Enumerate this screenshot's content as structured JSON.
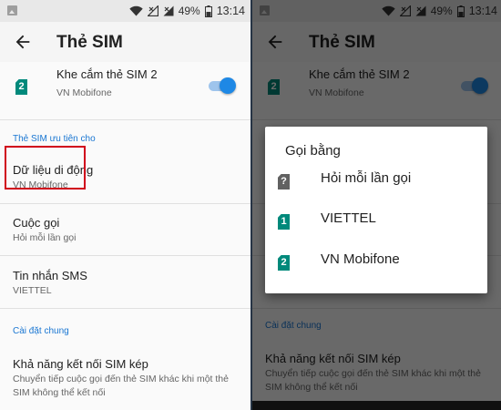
{
  "status_bar": {
    "battery_percent": "49%",
    "time": "13:14",
    "icons": [
      "gallery-icon",
      "wifi-icon",
      "signal-no-service-icon",
      "signal-strength-icon",
      "battery-icon"
    ]
  },
  "app_bar": {
    "title": "Thẻ SIM",
    "back_icon": "arrow-back-icon"
  },
  "sim2_slot": {
    "title": "Khe cắm thẻ SIM 2",
    "subtitle": "VN Mobifone",
    "badge": "2",
    "enabled": true
  },
  "preferred_section": {
    "header": "Thẻ SIM ưu tiên cho",
    "items": [
      {
        "title": "Dữ liệu di động",
        "subtitle": "VN Mobifone"
      },
      {
        "title": "Cuộc gọi",
        "subtitle": "Hỏi mỗi lần gọi"
      },
      {
        "title": "Tin nhắn SMS",
        "subtitle": "VIETTEL"
      }
    ]
  },
  "general_section": {
    "header": "Cài đặt chung",
    "item_title": "Khả năng kết nối SIM kép",
    "item_subtitle_line1": "Chuyển tiếp cuộc gọi đến thẻ SIM khác khi một thẻ",
    "item_subtitle_line2": "SIM không thể kết nối"
  },
  "call_dialog": {
    "title": "Gọi bằng",
    "options": [
      {
        "label": "Hỏi mỗi lần gọi",
        "badge": "?"
      },
      {
        "label": "VIETTEL",
        "badge": "1"
      },
      {
        "label": "VN Mobifone",
        "badge": "2"
      }
    ]
  },
  "colors": {
    "accent": "#1976d2",
    "sim_badge": "#00897b",
    "highlight": "#d0021b",
    "toggle_thumb": "#1e88e5"
  }
}
